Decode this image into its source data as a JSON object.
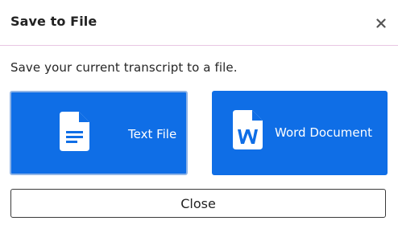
{
  "dialog": {
    "title": "Save to File",
    "close_icon": "close-icon",
    "description": "Save your current transcript to a file.",
    "options": [
      {
        "label": "Text File",
        "icon": "text-file-icon"
      },
      {
        "label": "Word Document",
        "icon": "word-document-icon"
      }
    ],
    "close_button_label": "Close",
    "colors": {
      "primary": "#0f6ee6",
      "focus_ring": "#8fb4e6",
      "header_divider": "#e8c6e3"
    }
  }
}
